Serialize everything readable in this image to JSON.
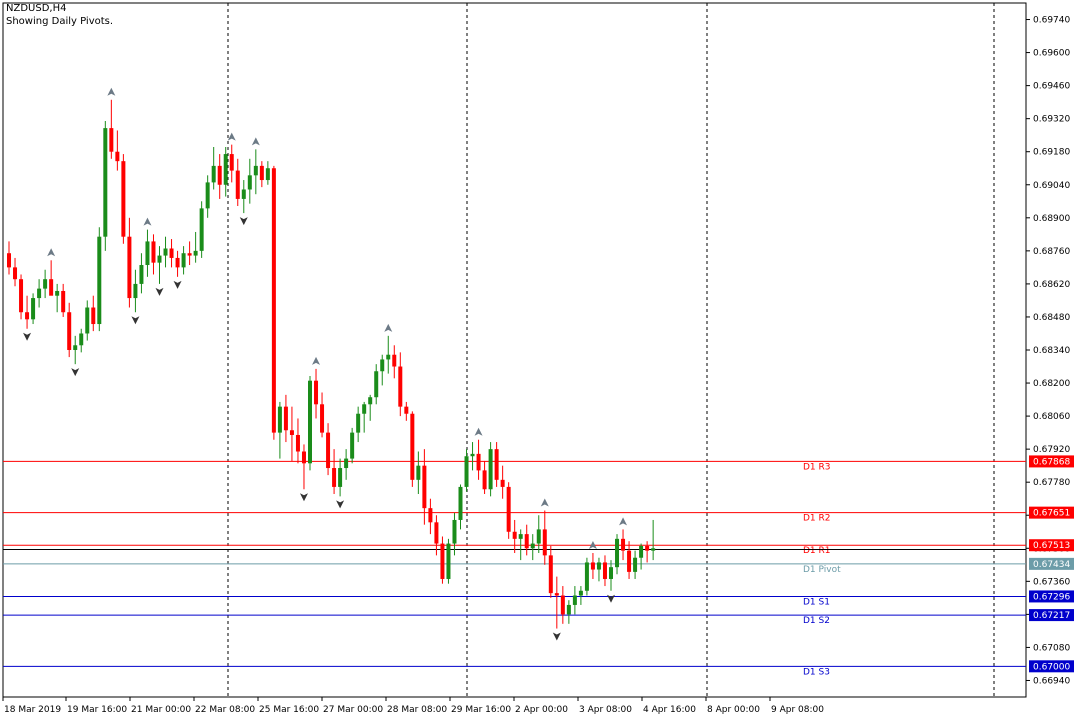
{
  "window_title": "NZDUSD,H4",
  "subtitle": "Showing Daily Pivots.",
  "chart_data": {
    "type": "candlestick",
    "symbol": "NZDUSD",
    "timeframe": "H4",
    "ylim": [
      0.6687,
      0.6981
    ],
    "y_ticks": [
      "0.69740",
      "0.69600",
      "0.69460",
      "0.69320",
      "0.69180",
      "0.69040",
      "0.68900",
      "0.68760",
      "0.68620",
      "0.68480",
      "0.68340",
      "0.68200",
      "0.68060",
      "0.67920",
      "0.67780",
      "0.67640",
      "0.67500",
      "0.67360",
      "0.67220",
      "0.67080",
      "0.66940"
    ],
    "x_labels": [
      "18 Mar 2019",
      "19 Mar 16:00",
      "21 Mar 00:00",
      "22 Mar 08:00",
      "25 Mar 16:00",
      "27 Mar 00:00",
      "28 Mar 08:00",
      "29 Mar 16:00",
      "2 Apr 00:00",
      "3 Apr 08:00",
      "4 Apr 16:00",
      "8 Apr 00:00",
      "9 Apr 08:00"
    ],
    "colors": {
      "bull": "#1a8c1a",
      "bear": "#ff0000",
      "resistance": "#ff0000",
      "support": "#0000cc",
      "pivot": "#6c9ca8"
    },
    "pivot_levels": [
      {
        "name": "D1 R3",
        "value": 0.67868,
        "tag": "0.67868",
        "kind": "resistance"
      },
      {
        "name": "D1 R2",
        "value": 0.67651,
        "tag": "0.67651",
        "kind": "resistance"
      },
      {
        "name": "D1 R1",
        "value": 0.67513,
        "tag": "0.67513",
        "kind": "resistance"
      },
      {
        "name": "D1 Pivot",
        "value": 0.67434,
        "tag": "0.67434",
        "kind": "pivot"
      },
      {
        "name": "D1 S1",
        "value": 0.67296,
        "tag": "0.67296",
        "kind": "support"
      },
      {
        "name": "D1 S2",
        "value": 0.67217,
        "tag": "0.67217",
        "kind": "support"
      },
      {
        "name": "D1 S3",
        "value": 0.67,
        "tag": "0.67000",
        "kind": "support"
      }
    ],
    "current_price": 0.67495,
    "ohlc": [
      [
        0.6875,
        0.688,
        0.6866,
        0.6869
      ],
      [
        0.6869,
        0.6873,
        0.6861,
        0.6864
      ],
      [
        0.6864,
        0.6866,
        0.6847,
        0.685
      ],
      [
        0.685,
        0.6857,
        0.6843,
        0.6847
      ],
      [
        0.6847,
        0.6858,
        0.6845,
        0.6856
      ],
      [
        0.6856,
        0.6864,
        0.6852,
        0.686
      ],
      [
        0.686,
        0.6868,
        0.6856,
        0.6864
      ],
      [
        0.6864,
        0.6872,
        0.686,
        0.6857
      ],
      [
        0.6857,
        0.6862,
        0.685,
        0.6859
      ],
      [
        0.6859,
        0.6862,
        0.6848,
        0.685
      ],
      [
        0.685,
        0.6854,
        0.6831,
        0.6834
      ],
      [
        0.6834,
        0.684,
        0.6828,
        0.6836
      ],
      [
        0.6836,
        0.6843,
        0.6833,
        0.6841
      ],
      [
        0.6841,
        0.6855,
        0.6838,
        0.6852
      ],
      [
        0.6852,
        0.6857,
        0.6842,
        0.6845
      ],
      [
        0.6845,
        0.6886,
        0.6842,
        0.6882
      ],
      [
        0.6882,
        0.6931,
        0.6876,
        0.6928
      ],
      [
        0.6928,
        0.694,
        0.6915,
        0.6918
      ],
      [
        0.6918,
        0.6927,
        0.691,
        0.6914
      ],
      [
        0.6914,
        0.6917,
        0.6879,
        0.6882
      ],
      [
        0.6882,
        0.689,
        0.6852,
        0.6856
      ],
      [
        0.6856,
        0.6868,
        0.685,
        0.6862
      ],
      [
        0.6862,
        0.6875,
        0.6858,
        0.687
      ],
      [
        0.687,
        0.6885,
        0.6865,
        0.688
      ],
      [
        0.688,
        0.6883,
        0.6866,
        0.6871
      ],
      [
        0.6871,
        0.6878,
        0.6862,
        0.6874
      ],
      [
        0.6874,
        0.6882,
        0.6869,
        0.6877
      ],
      [
        0.6877,
        0.6881,
        0.6869,
        0.6873
      ],
      [
        0.6873,
        0.6876,
        0.6865,
        0.6869
      ],
      [
        0.6869,
        0.6878,
        0.6866,
        0.6875
      ],
      [
        0.6875,
        0.688,
        0.687,
        0.6874
      ],
      [
        0.6874,
        0.6884,
        0.6871,
        0.6876
      ],
      [
        0.6876,
        0.6897,
        0.6873,
        0.6894
      ],
      [
        0.6894,
        0.6908,
        0.689,
        0.6905
      ],
      [
        0.6905,
        0.692,
        0.6902,
        0.6912
      ],
      [
        0.6912,
        0.6917,
        0.6898,
        0.6904
      ],
      [
        0.6904,
        0.692,
        0.6899,
        0.6917
      ],
      [
        0.6917,
        0.6921,
        0.6905,
        0.691
      ],
      [
        0.691,
        0.6915,
        0.6895,
        0.6898
      ],
      [
        0.6898,
        0.6906,
        0.6892,
        0.6902
      ],
      [
        0.6902,
        0.6915,
        0.6896,
        0.6908
      ],
      [
        0.6908,
        0.6919,
        0.69,
        0.6912
      ],
      [
        0.6912,
        0.6914,
        0.6903,
        0.6906
      ],
      [
        0.6906,
        0.6914,
        0.6904,
        0.6911
      ],
      [
        0.6911,
        0.6912,
        0.6796,
        0.6799
      ],
      [
        0.6799,
        0.6812,
        0.6788,
        0.681
      ],
      [
        0.681,
        0.6815,
        0.6795,
        0.68
      ],
      [
        0.68,
        0.681,
        0.6787,
        0.6798
      ],
      [
        0.6798,
        0.6805,
        0.6786,
        0.6791
      ],
      [
        0.6791,
        0.6794,
        0.6775,
        0.6786
      ],
      [
        0.6786,
        0.6823,
        0.6783,
        0.6821
      ],
      [
        0.6821,
        0.6826,
        0.6805,
        0.6811
      ],
      [
        0.6811,
        0.6816,
        0.6797,
        0.6799
      ],
      [
        0.6799,
        0.6803,
        0.6781,
        0.6784
      ],
      [
        0.6784,
        0.6792,
        0.6773,
        0.6776
      ],
      [
        0.6776,
        0.6788,
        0.6772,
        0.6784
      ],
      [
        0.6784,
        0.6792,
        0.6779,
        0.6788
      ],
      [
        0.6788,
        0.6801,
        0.6786,
        0.6799
      ],
      [
        0.6799,
        0.681,
        0.6795,
        0.6807
      ],
      [
        0.6807,
        0.6812,
        0.6799,
        0.6811
      ],
      [
        0.6811,
        0.6815,
        0.6804,
        0.6814
      ],
      [
        0.6814,
        0.6828,
        0.6811,
        0.6825
      ],
      [
        0.6825,
        0.6832,
        0.6819,
        0.683
      ],
      [
        0.683,
        0.684,
        0.6824,
        0.6832
      ],
      [
        0.6832,
        0.6836,
        0.6822,
        0.6827
      ],
      [
        0.6827,
        0.6833,
        0.6806,
        0.681
      ],
      [
        0.681,
        0.6812,
        0.6804,
        0.6807
      ],
      [
        0.6807,
        0.6808,
        0.6776,
        0.6779
      ],
      [
        0.6779,
        0.6791,
        0.6773,
        0.6785
      ],
      [
        0.6785,
        0.6792,
        0.676,
        0.6767
      ],
      [
        0.6767,
        0.6771,
        0.6756,
        0.6761
      ],
      [
        0.6761,
        0.6764,
        0.6747,
        0.6752
      ],
      [
        0.6752,
        0.6755,
        0.6735,
        0.6737
      ],
      [
        0.6737,
        0.6754,
        0.6735,
        0.6752
      ],
      [
        0.6752,
        0.6765,
        0.6747,
        0.6762
      ],
      [
        0.6762,
        0.6777,
        0.6758,
        0.6776
      ],
      [
        0.6776,
        0.6792,
        0.6774,
        0.6789
      ],
      [
        0.6789,
        0.6795,
        0.6783,
        0.679
      ],
      [
        0.679,
        0.6796,
        0.6779,
        0.6783
      ],
      [
        0.6783,
        0.6787,
        0.6773,
        0.6775
      ],
      [
        0.6775,
        0.6795,
        0.6772,
        0.6792
      ],
      [
        0.6792,
        0.6795,
        0.6776,
        0.6779
      ],
      [
        0.6779,
        0.6785,
        0.6771,
        0.6776
      ],
      [
        0.6776,
        0.6778,
        0.6754,
        0.6757
      ],
      [
        0.6757,
        0.6762,
        0.6748,
        0.6754
      ],
      [
        0.6754,
        0.6758,
        0.6745,
        0.6756
      ],
      [
        0.6756,
        0.676,
        0.6747,
        0.675
      ],
      [
        0.675,
        0.6756,
        0.6745,
        0.6752
      ],
      [
        0.6752,
        0.6764,
        0.6748,
        0.6758
      ],
      [
        0.6758,
        0.6766,
        0.6743,
        0.6747
      ],
      [
        0.6747,
        0.6751,
        0.6729,
        0.6731
      ],
      [
        0.6731,
        0.6738,
        0.6716,
        0.673
      ],
      [
        0.673,
        0.6734,
        0.6718,
        0.6722
      ],
      [
        0.6722,
        0.6728,
        0.6718,
        0.6726
      ],
      [
        0.6726,
        0.6734,
        0.6722,
        0.673
      ],
      [
        0.673,
        0.6734,
        0.6726,
        0.6732
      ],
      [
        0.6732,
        0.6746,
        0.673,
        0.6744
      ],
      [
        0.6744,
        0.6748,
        0.6737,
        0.6741
      ],
      [
        0.6741,
        0.6746,
        0.6736,
        0.6744
      ],
      [
        0.6744,
        0.6747,
        0.6734,
        0.6737
      ],
      [
        0.6737,
        0.6745,
        0.6732,
        0.6742
      ],
      [
        0.6742,
        0.6756,
        0.6739,
        0.6754
      ],
      [
        0.6754,
        0.6758,
        0.6745,
        0.6749
      ],
      [
        0.6749,
        0.6753,
        0.6737,
        0.674
      ],
      [
        0.674,
        0.6749,
        0.6737,
        0.6746
      ],
      [
        0.6746,
        0.6752,
        0.6741,
        0.6751
      ],
      [
        0.6751,
        0.6753,
        0.6744,
        0.6749
      ],
      [
        0.6749,
        0.6762,
        0.6745,
        0.675
      ]
    ]
  }
}
